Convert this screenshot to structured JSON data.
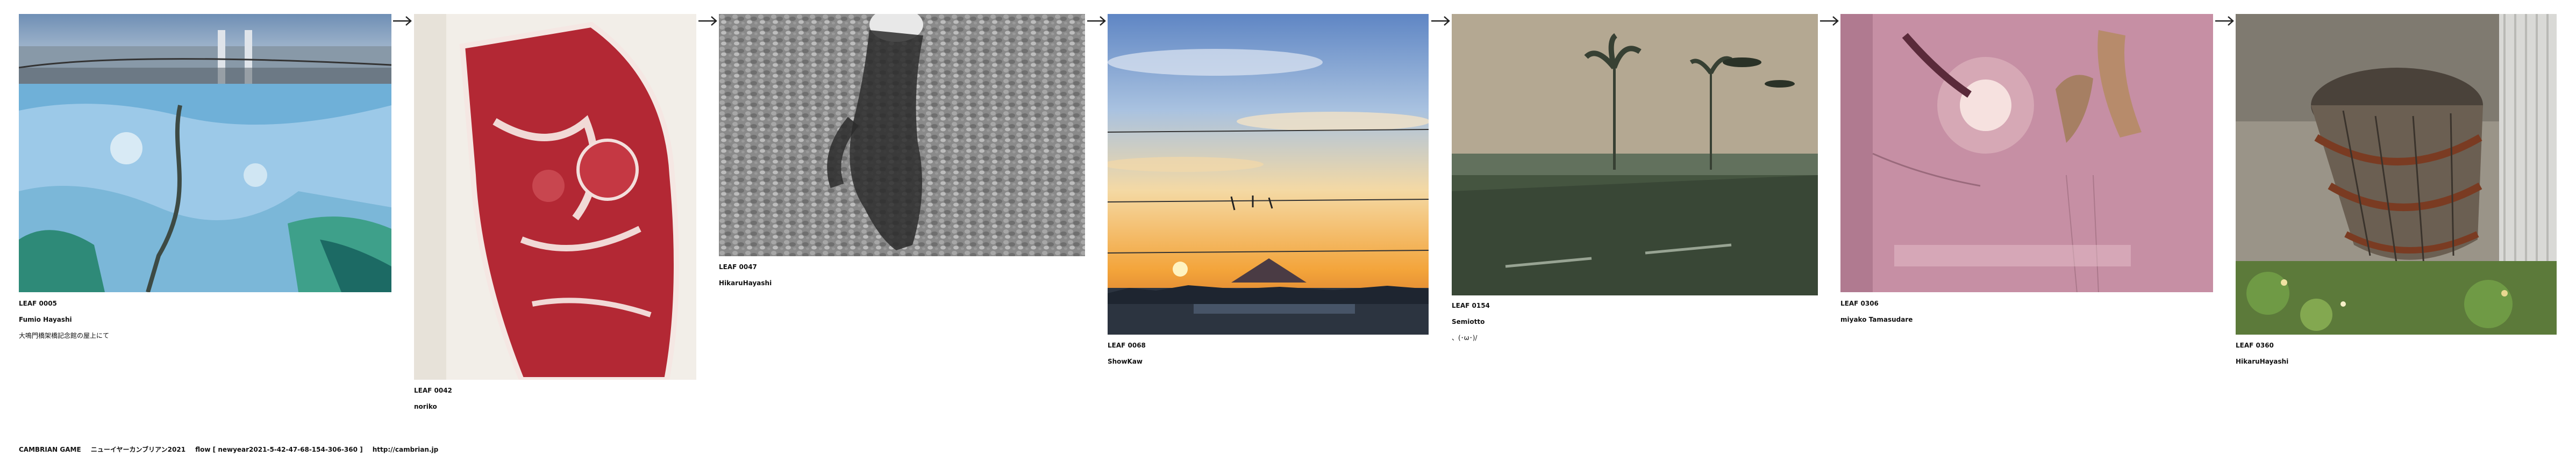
{
  "game": {
    "leaves": [
      {
        "id": "LEAF 0005",
        "author": "Fumio Hayashi",
        "comment": "大鳴門橋架橋記念館の屋上にて",
        "photo": "photo-bridge-rooftop-map"
      },
      {
        "id": "LEAF 0042",
        "author": "noriko",
        "comment": "",
        "photo": "photo-marbled-beef"
      },
      {
        "id": "LEAF 0047",
        "author": "HikaruHayashi",
        "comment": "",
        "photo": "photo-pebble-shadow"
      },
      {
        "id": "LEAF 0068",
        "author": "ShowKaw",
        "comment": "",
        "photo": "photo-sunset-mount-fuji"
      },
      {
        "id": "LEAF 0154",
        "author": "Semiotto",
        "comment": "、(･ω･)/",
        "photo": "photo-palm-trees-road"
      },
      {
        "id": "LEAF 0306",
        "author": "miyako Tamasudare",
        "comment": "",
        "photo": "photo-pink-cloth-flowers"
      },
      {
        "id": "LEAF 0360",
        "author": "HikaruHayashi",
        "comment": "",
        "photo": "photo-wooden-barrel"
      }
    ],
    "arrow_glyph": "→"
  },
  "footer": {
    "title": "CAMBRIAN GAME",
    "name": "ニューイヤーカンブリアン2021",
    "flow": "flow [ newyear2021-5-42-47-68-154-306-360 ]",
    "url": "http://cambrian.jp"
  }
}
